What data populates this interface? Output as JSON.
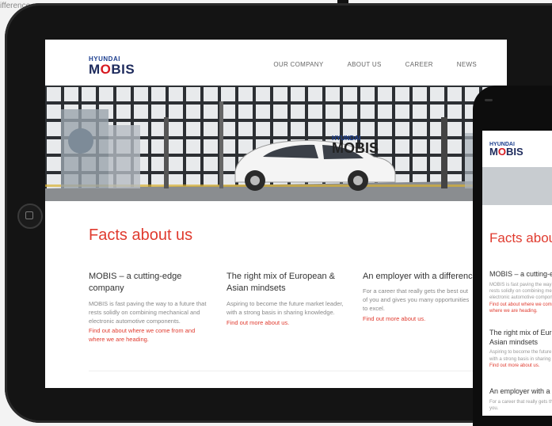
{
  "background": {
    "snippet": "ifference"
  },
  "site": {
    "brand_top": "HYUNDAI",
    "brand_name_pre": "M",
    "brand_name_o": "O",
    "brand_name_post": "BIS",
    "nav": [
      "OUR COMPANY",
      "ABOUT US",
      "CAREER",
      "NEWS"
    ],
    "hero_brand_top": "HYUNDAI",
    "hero_brand_name": "MOBIS",
    "title": "Facts about us",
    "columns": [
      {
        "heading": "MOBIS – a cutting-edge company",
        "body": "MOBIS is fast paving the way to a future that rests solidly on combining mechanical and electronic automotive components.",
        "link": "Find out about where we come from and where we are heading."
      },
      {
        "heading": "The right mix of European & Asian mindsets",
        "body": "Aspiring to become the future market leader, with a strong basis in sharing knowledge.",
        "link": "Find out more about us."
      },
      {
        "heading": "An employer with a difference",
        "body": "For a career that really gets the best out of you and gives you many opportunities to excel.",
        "link": "Find out more about us."
      }
    ]
  },
  "phone": {
    "brand_top": "HYUNDAI",
    "title": "Facts about us",
    "sec1_heading": "MOBIS – a cutting-edge company",
    "sec1_body": "MOBIS is fast paving the way to a future that rests solidly on combining mechanical and electronic automotive components.",
    "sec1_link": "Find out about where we come from and where we are heading.",
    "sec2_heading": "The right mix of European & Asian mindsets",
    "sec2_body": "Aspiring to become the future market leader, with a strong basis in sharing knowledge.",
    "sec2_link": "Find out more about us.",
    "sec3_heading": "An employer with a difference",
    "sec3_body": "For a career that really gets the best out of you."
  },
  "colors": {
    "accent": "#e03b2f",
    "brand_blue": "#1d3f8f",
    "device": "#141414"
  }
}
